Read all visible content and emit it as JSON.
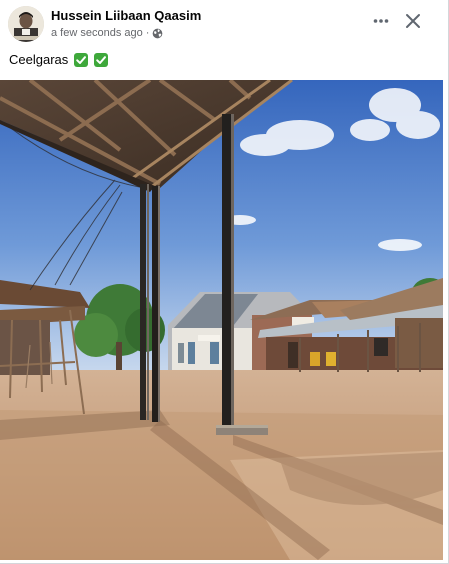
{
  "post": {
    "author": "Hussein Liibaan Qaasim",
    "timestamp": "a few seconds ago",
    "separator": "·",
    "audience_icon": "globe-icon",
    "caption": "Ceelgaras",
    "caption_emojis": [
      "check-mark-button",
      "check-mark-button"
    ],
    "photo": {
      "subject": "street scene under a corrugated roof veranda",
      "wall_signs": [
        "",
        ""
      ]
    }
  },
  "header_actions": {
    "more_icon": "more-horizontal-icon",
    "close_icon": "close-icon"
  },
  "colors": {
    "author_text": "#050505",
    "meta_text": "#65676b",
    "emoji_green": "#3ea83b",
    "sky": "#3b6fc4",
    "ground": "#c49a74"
  }
}
